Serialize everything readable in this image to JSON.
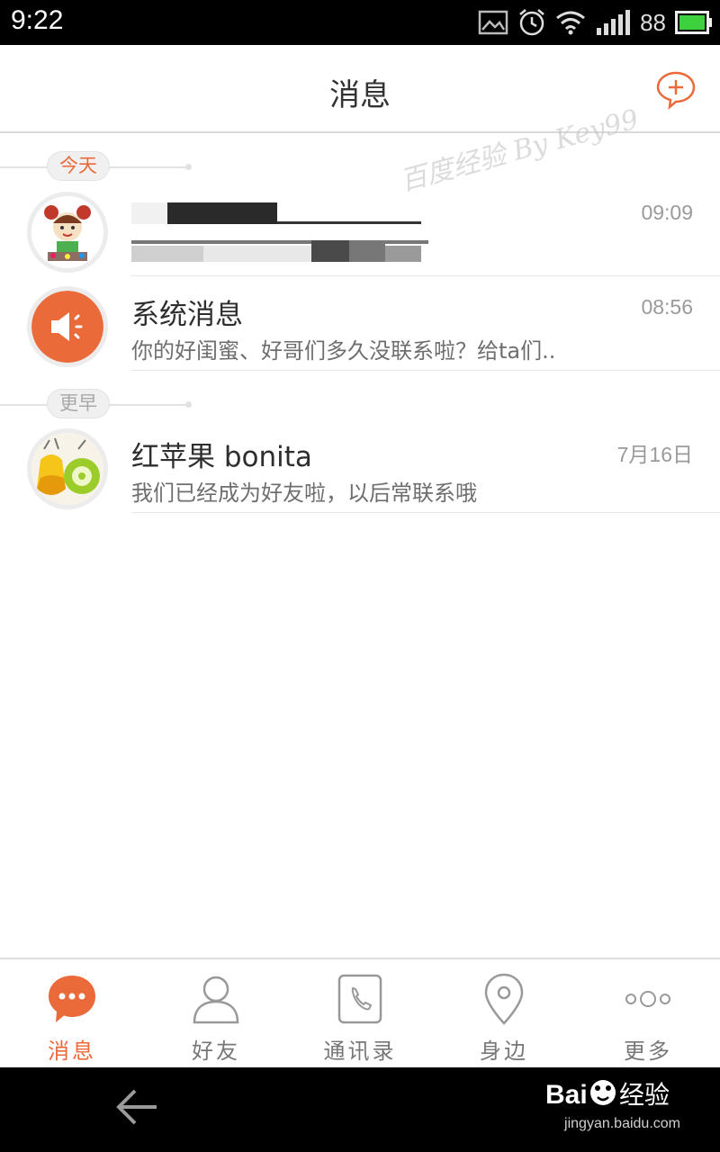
{
  "status_bar": {
    "time": "9:22",
    "battery_level": "88",
    "icons": [
      "image-icon",
      "alarm-icon",
      "wifi-icon",
      "signal-icon",
      "battery-icon"
    ]
  },
  "header": {
    "title": "消息",
    "action_icon": "add-chat-icon",
    "watermark": "百度经验 By Key99"
  },
  "sections": {
    "today": "今天",
    "earlier": "更早"
  },
  "conversations": [
    {
      "name": "",
      "time": "09:09",
      "preview": "",
      "avatar": "cartoon-avatar",
      "redacted": true
    },
    {
      "name": "系统消息",
      "time": "08:56",
      "preview": "你的好闺蜜、好哥们多久没联系啦？给ta们..",
      "avatar": "speaker-avatar"
    },
    {
      "name": "红苹果 bonita",
      "time": "7月16日",
      "preview": "我们已经成为好友啦，以后常联系哦",
      "avatar": "fruit-avatar"
    }
  ],
  "tabbar": [
    {
      "label": "消息",
      "icon": "chat-bubble-icon",
      "active": true
    },
    {
      "label": "好友",
      "icon": "person-icon",
      "active": false
    },
    {
      "label": "通讯录",
      "icon": "phone-book-icon",
      "active": false
    },
    {
      "label": "身边",
      "icon": "location-pin-icon",
      "active": false
    },
    {
      "label": "更多",
      "icon": "more-icon",
      "active": false
    }
  ],
  "nav_bar": {
    "back_icon": "back-arrow-icon",
    "brand_logo": "Bai du 经验",
    "brand_url": "jingyan.baidu.com"
  },
  "colors": {
    "accent": "#ea6a3a",
    "status_bar": "#000000",
    "divider": "#e6e6e6"
  }
}
